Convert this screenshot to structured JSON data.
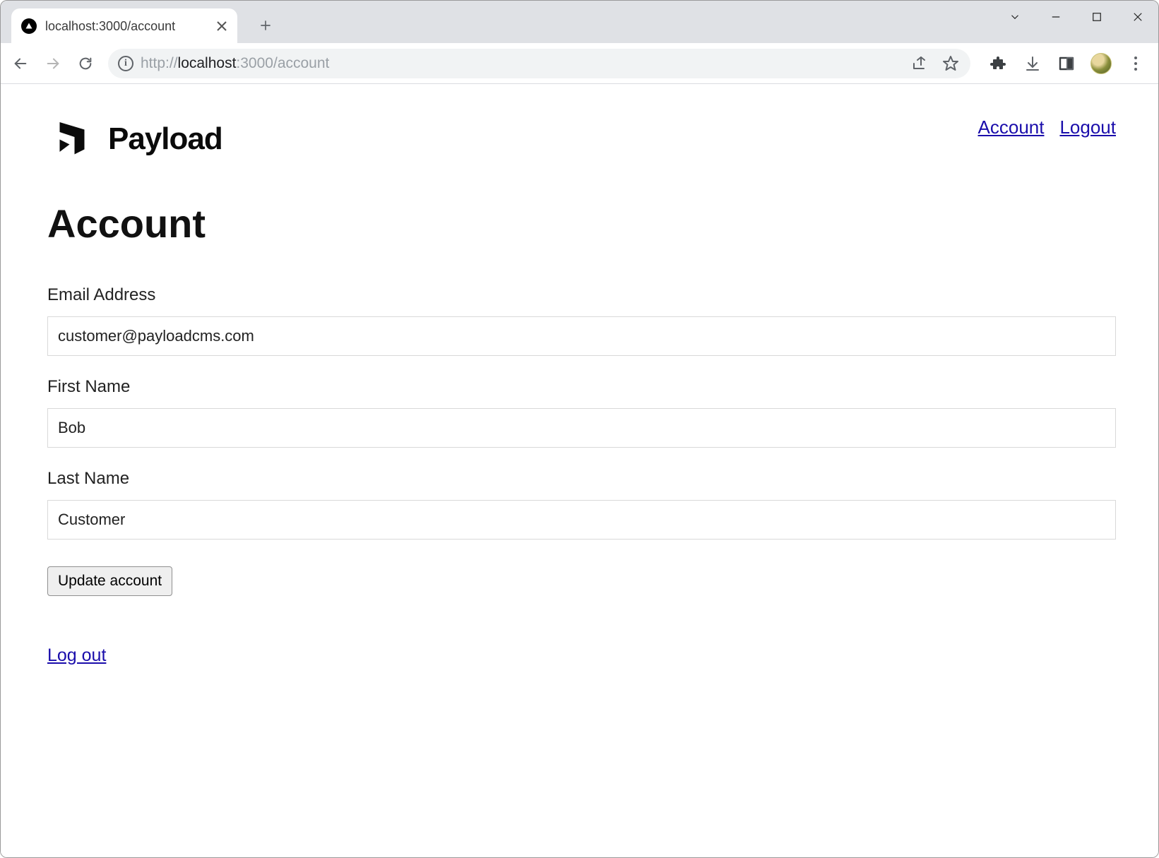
{
  "browser": {
    "tab_title": "localhost:3000/account",
    "url_scheme": "http://",
    "url_host": "localhost",
    "url_port": ":3000",
    "url_path": "/account"
  },
  "page": {
    "brand_name": "Payload",
    "nav": {
      "account": "Account",
      "logout": "Logout"
    },
    "title": "Account",
    "form": {
      "email_label": "Email Address",
      "email_value": "customer@payloadcms.com",
      "first_name_label": "First Name",
      "first_name_value": "Bob",
      "last_name_label": "Last Name",
      "last_name_value": "Customer",
      "submit_label": "Update account"
    },
    "logout_link": "Log out"
  },
  "colors": {
    "link": "#1a0dab",
    "border": "#d9d9d9",
    "chrome_bg": "#dfe1e5",
    "omnibox_bg": "#f1f3f4"
  }
}
